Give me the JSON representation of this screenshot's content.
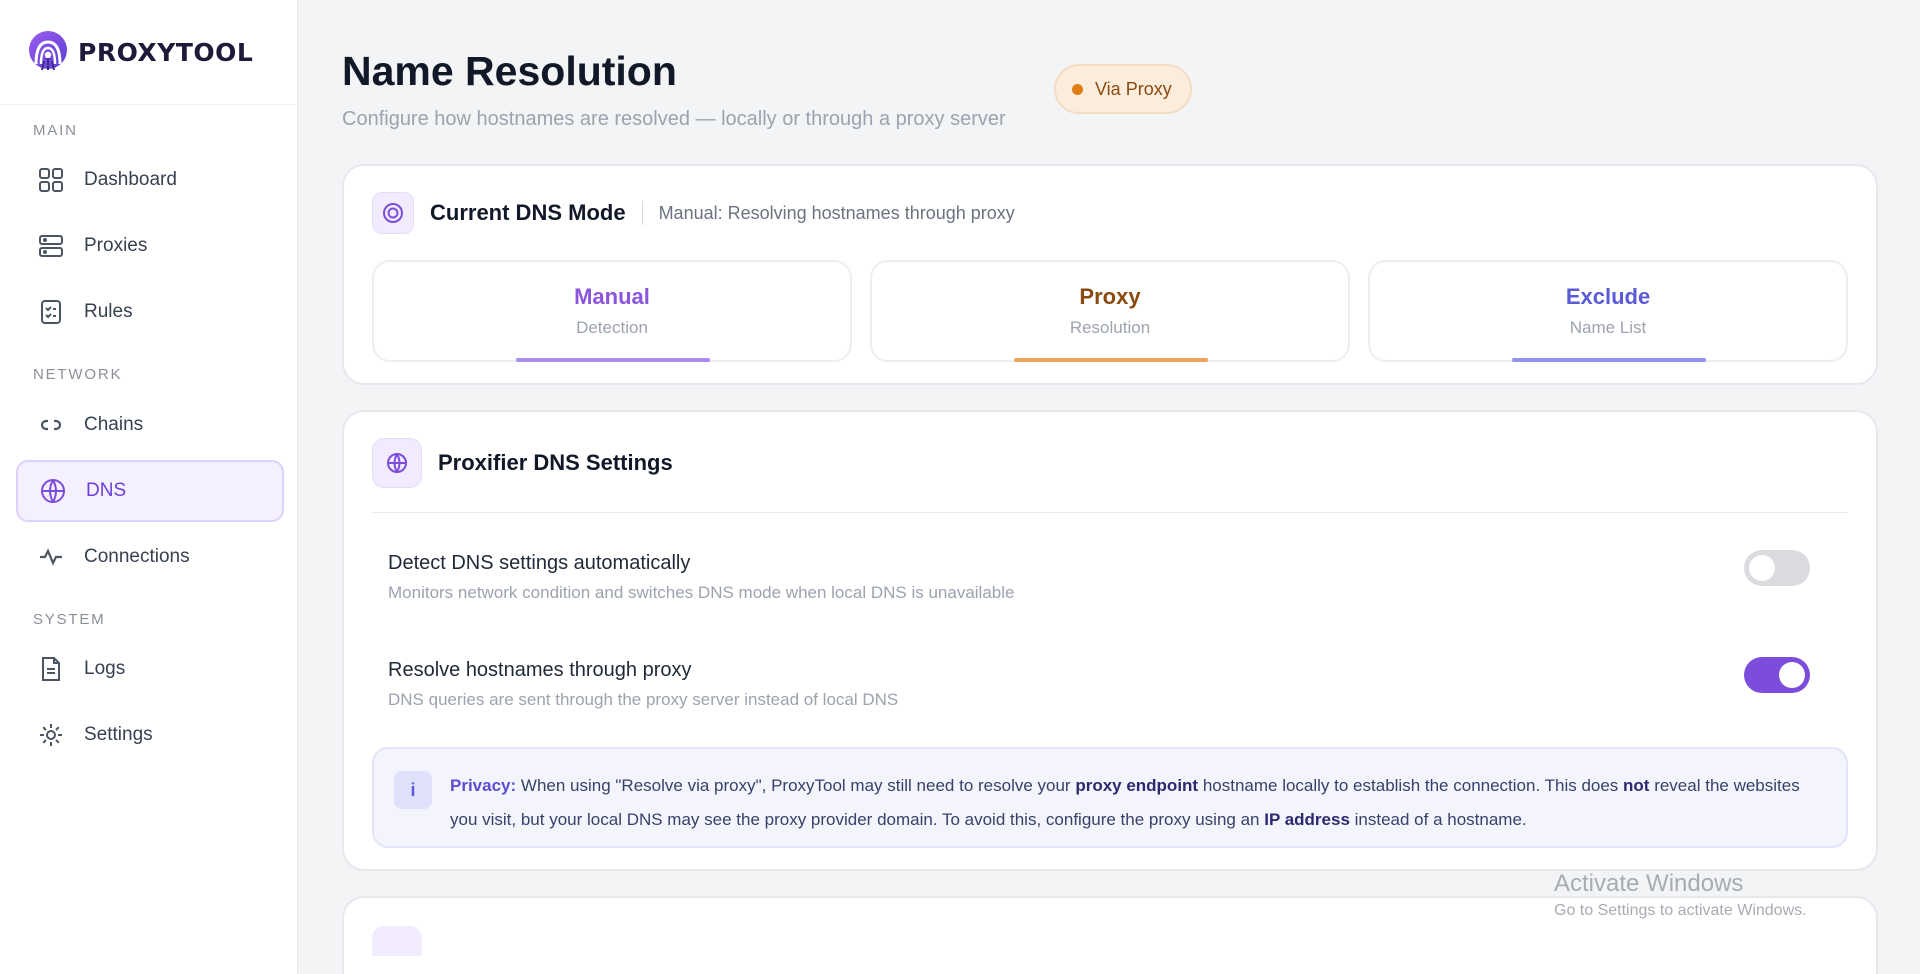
{
  "brand": {
    "name": "PROXYTOOL"
  },
  "sidebar": {
    "sections": [
      {
        "label": "MAIN"
      },
      {
        "label": "NETWORK"
      },
      {
        "label": "SYSTEM"
      }
    ],
    "items": [
      {
        "label": "Dashboard",
        "icon": "grid-icon"
      },
      {
        "label": "Proxies",
        "icon": "server-icon"
      },
      {
        "label": "Rules",
        "icon": "checklist-icon"
      },
      {
        "label": "Chains",
        "icon": "link-icon"
      },
      {
        "label": "DNS",
        "icon": "globe-icon",
        "active": true
      },
      {
        "label": "Connections",
        "icon": "activity-icon"
      },
      {
        "label": "Logs",
        "icon": "document-icon"
      },
      {
        "label": "Settings",
        "icon": "gear-icon"
      }
    ]
  },
  "header": {
    "title": "Name Resolution",
    "subtitle": "Configure how hostnames are resolved — locally or through a proxy server",
    "badge": "Via Proxy"
  },
  "dns_mode": {
    "title": "Current DNS Mode",
    "description": "Manual: Resolving hostnames through proxy",
    "modes": [
      {
        "value": "Manual",
        "label": "Detection",
        "color": "#8b55dc",
        "bar": "#a98bf0"
      },
      {
        "value": "Proxy",
        "label": "Resolution",
        "color": "#8a4a10",
        "bar": "#eea25a"
      },
      {
        "value": "Exclude",
        "label": "Name List",
        "color": "#5b5bd6",
        "bar": "#8f95ee"
      }
    ]
  },
  "dns_settings": {
    "title": "Proxifier DNS Settings",
    "settings": [
      {
        "title": "Detect DNS settings automatically",
        "description": "Monitors network condition and switches DNS mode when local DNS is unavailable",
        "enabled": false
      },
      {
        "title": "Resolve hostnames through proxy",
        "description": "DNS queries are sent through the proxy server instead of local DNS",
        "enabled": true
      }
    ],
    "privacy": {
      "icon": "i",
      "lead": "Privacy:",
      "t1": " When using \"Resolve via proxy\", ProxyTool may still need to resolve your ",
      "b1": "proxy endpoint",
      "t2": " hostname locally to establish the connection. This does ",
      "b2": "not",
      "t3": " reveal the websites you visit, but your local DNS may see the proxy provider domain. To avoid this, configure the proxy using an ",
      "b3": "IP address",
      "t4": " instead of a hostname."
    }
  },
  "watermark": {
    "line1": "Activate Windows",
    "line2": "Go to Settings to activate Windows."
  },
  "colors": {
    "accent": "#7c4ddb",
    "badge": "#e07d12"
  }
}
